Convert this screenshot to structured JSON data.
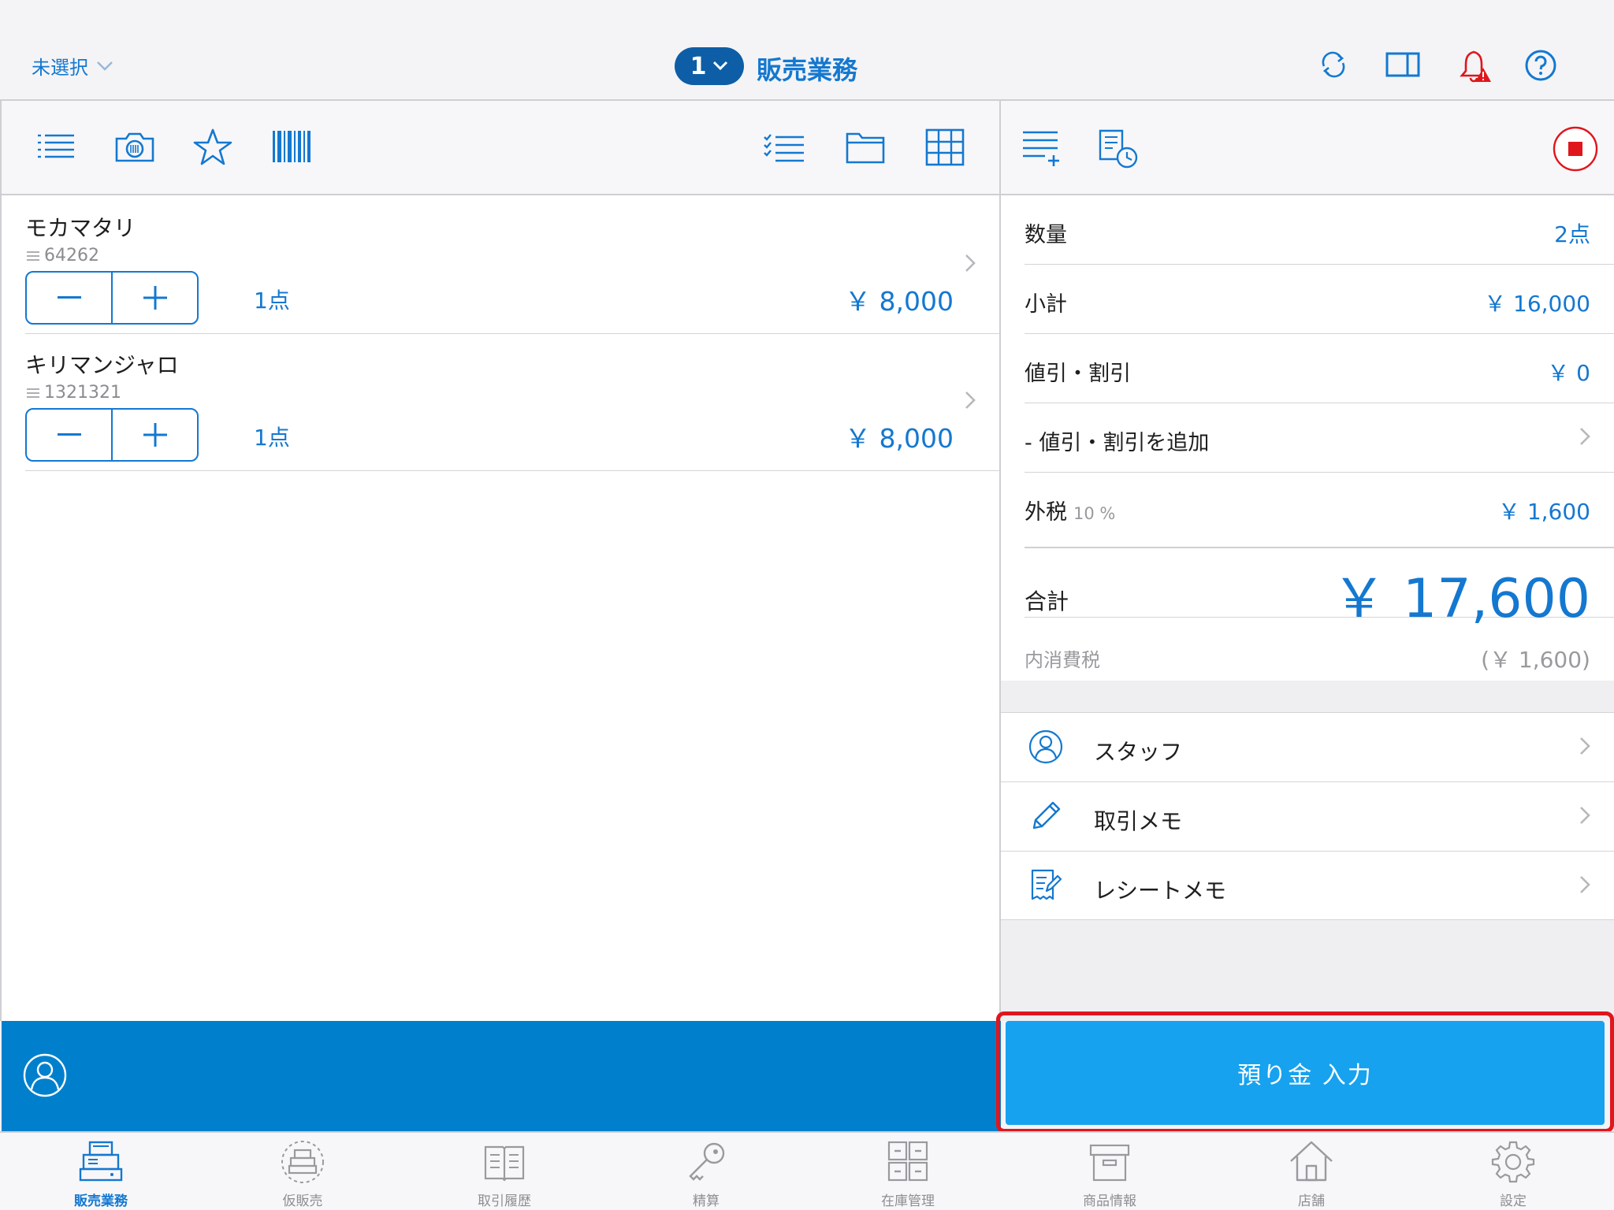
{
  "header": {
    "store_selector": "未選択",
    "register_number": "1",
    "title": "販売業務"
  },
  "cart": {
    "items": [
      {
        "name": "モカマタリ",
        "code": "64262",
        "qty": "1点",
        "price": "￥ 8,000"
      },
      {
        "name": "キリマンジャロ",
        "code": "1321321",
        "qty": "1点",
        "price": "￥ 8,000"
      }
    ]
  },
  "summary": {
    "quantity_label": "数量",
    "quantity_value": "2点",
    "subtotal_label": "小計",
    "subtotal_value": "￥ 16,000",
    "discount_label": "値引・割引",
    "discount_value": "￥ 0",
    "add_discount_label": "- 値引・割引を追加",
    "tax_label": "外税",
    "tax_rate": "10 %",
    "tax_value": "￥ 1,600",
    "total_label": "合計",
    "total_value": "￥ 17,600",
    "included_tax_label": "内消費税",
    "included_tax_value": "(￥ 1,600)"
  },
  "options": {
    "staff_label": "スタッフ",
    "memo_label": "取引メモ",
    "receipt_memo_label": "レシートメモ"
  },
  "checkout": {
    "label": "預り金 入力"
  },
  "tabs": [
    {
      "label": "販売業務",
      "icon": "register-icon"
    },
    {
      "label": "仮販売",
      "icon": "temporary-sale-icon"
    },
    {
      "label": "取引履歴",
      "icon": "book-icon"
    },
    {
      "label": "精算",
      "icon": "key-icon"
    },
    {
      "label": "在庫管理",
      "icon": "cabinet-icon"
    },
    {
      "label": "商品情報",
      "icon": "box-icon"
    },
    {
      "label": "店舗",
      "icon": "store-icon"
    },
    {
      "label": "設定",
      "icon": "gear-icon"
    }
  ],
  "colors": {
    "accent": "#1478d0",
    "customer_bar": "#0080cc",
    "checkout_button": "#16a2ef",
    "highlight": "#e0161c",
    "alert": "#e0161c"
  }
}
